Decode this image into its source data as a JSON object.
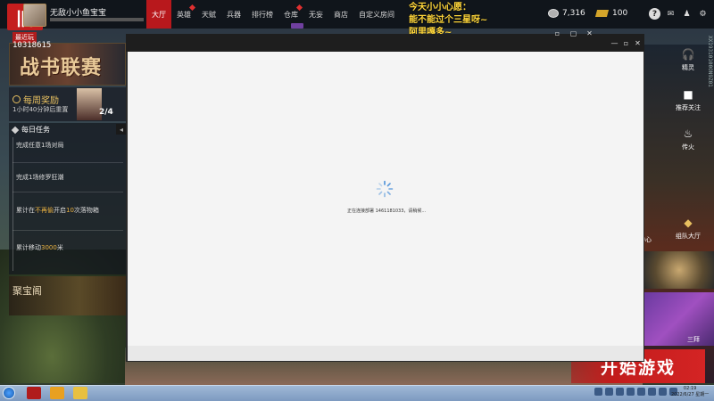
{
  "header": {
    "username": "无敌小小鱼宝宝",
    "nav": [
      {
        "label": "大厅",
        "active": true
      },
      {
        "label": "英雄",
        "dot": true
      },
      {
        "label": "天赋"
      },
      {
        "label": "兵器"
      },
      {
        "label": "排行榜"
      },
      {
        "label": "仓库",
        "dot": true
      },
      {
        "label": "无妄"
      },
      {
        "label": "商店"
      },
      {
        "label": "自定义房间"
      }
    ],
    "announcement_line1": "今天小小心愿：",
    "announcement_line2": "能不能过个三星呀~",
    "announcement_line3": "阿里嘎多~",
    "silver": "7,316",
    "gold": "100"
  },
  "left_panel": {
    "badge_text": "最近玩",
    "player_id": "10318615",
    "banner_title": "战书联赛",
    "weekly_title": "每周奖励",
    "weekly_subtitle": "1小时40分钟后重置",
    "weekly_count": "2/4",
    "daily_title": "每日任务",
    "tasks": [
      {
        "prefix": "完成任意1场对局",
        "hl": "",
        "suffix": ""
      },
      {
        "prefix": "完成1场修罗狂潮",
        "hl": "",
        "suffix": ""
      },
      {
        "prefix": "累计在",
        "hl": "不再偷",
        "mid": "开启",
        "hl2": "10",
        "suffix": "次落物箱"
      },
      {
        "prefix": "累计移动",
        "hl": "",
        "hl2": "3000",
        "suffix": "米"
      }
    ],
    "treasure_label": "聚宝阁"
  },
  "right_panel": {
    "items": [
      {
        "label": "精灵",
        "icon": "headset-icon"
      },
      {
        "label": "推荐关注",
        "icon": "camera-icon"
      },
      {
        "label": "传火",
        "icon": "flame-icon"
      },
      {
        "label": "组队大厅",
        "icon": "team-icon"
      }
    ],
    "center_label": "中心",
    "card_label": "三拜",
    "side_text": "XX19310100ON9Z01",
    "start_button": "开始游戏"
  },
  "modal": {
    "status_text": "正在连接部署 1461181033，请稍候..."
  },
  "taskbar": {
    "time": "02:19",
    "date": "2022/6/27 星期一"
  },
  "colors": {
    "accent_red": "#c21c1c",
    "announcement_yellow": "#ffd63a"
  }
}
